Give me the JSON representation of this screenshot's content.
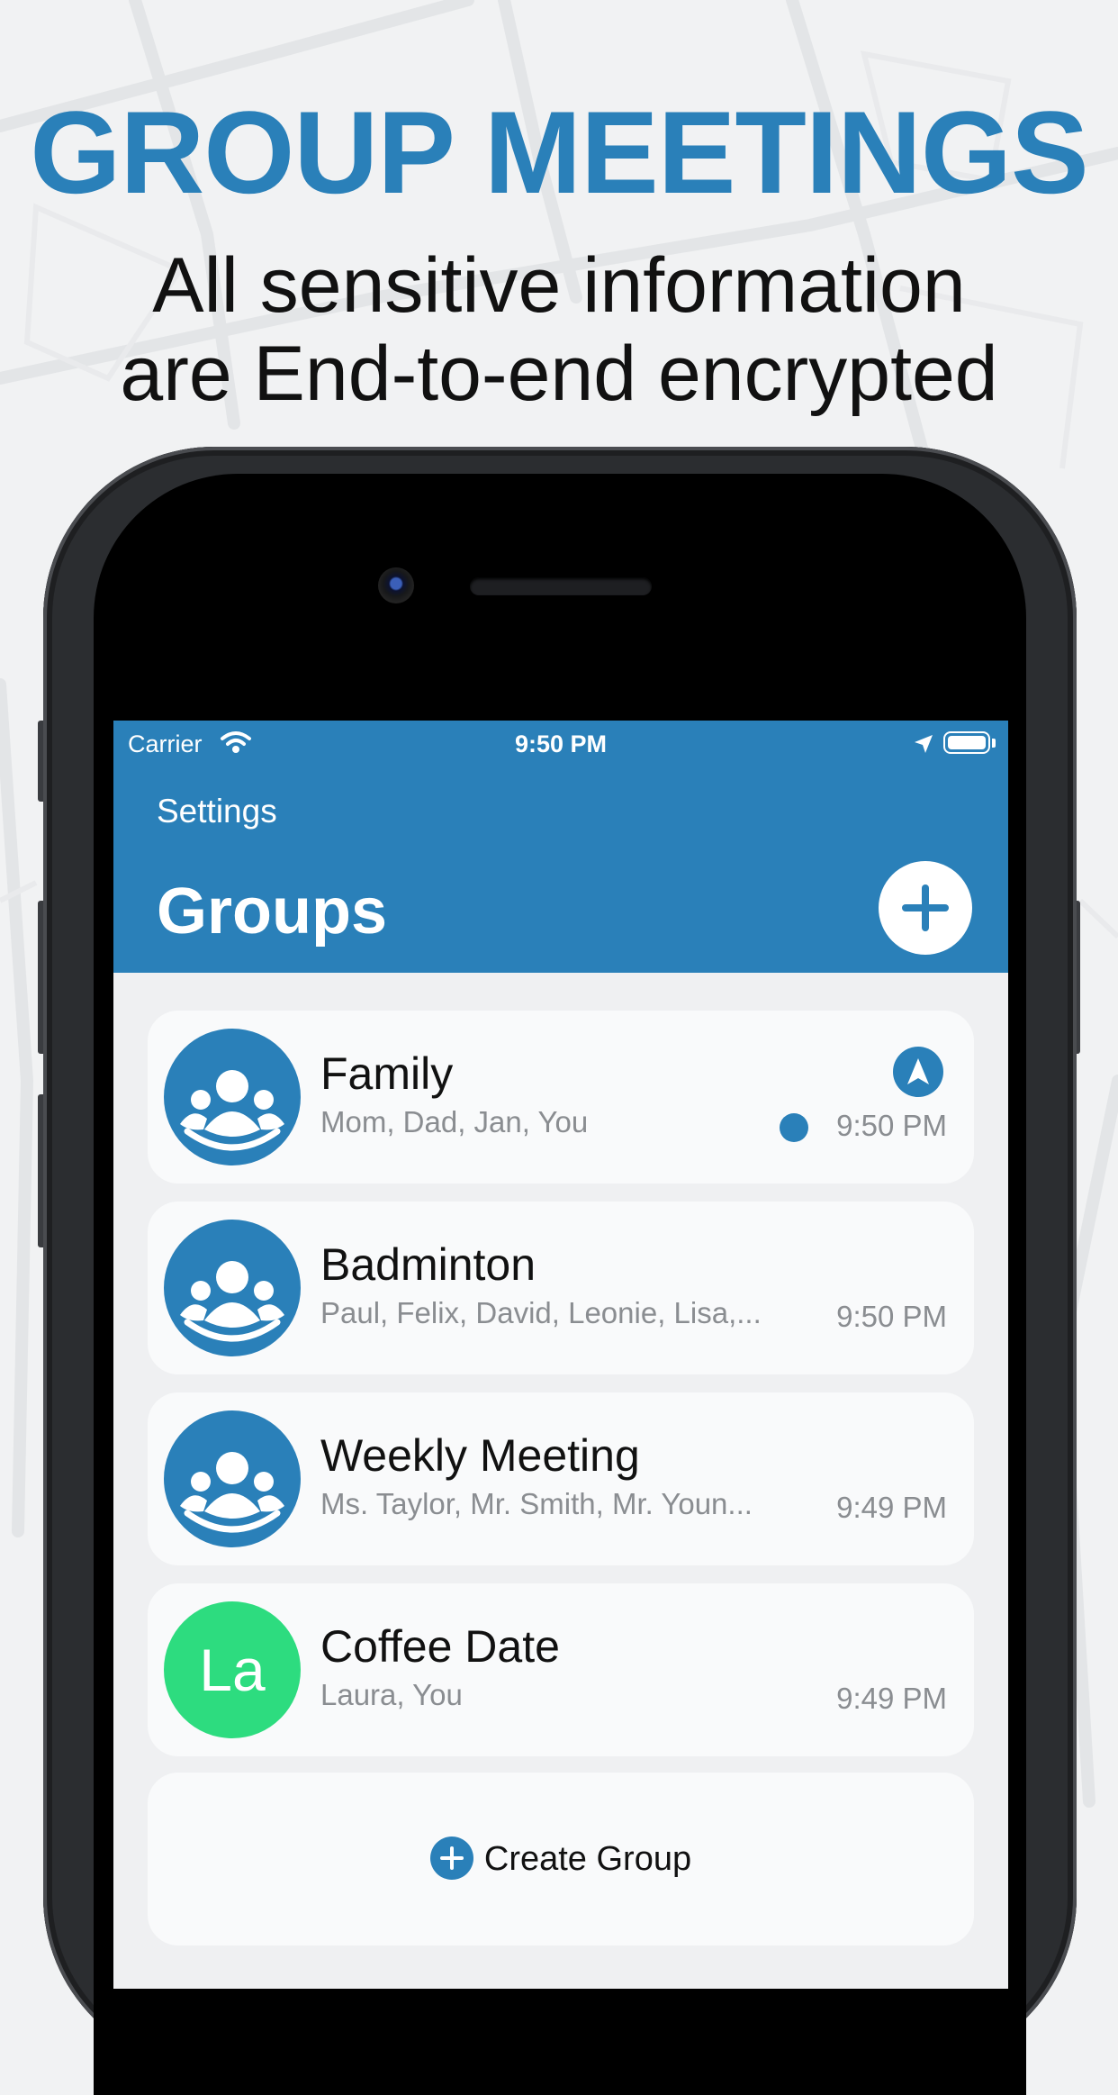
{
  "promo": {
    "title": "GROUP MEETINGS",
    "subtitle_line1": "All sensitive information",
    "subtitle_line2": "are End-to-end encrypted"
  },
  "status_bar": {
    "carrier": "Carrier",
    "time": "9:50 PM",
    "icons": [
      "wifi-icon",
      "location-arrow-icon",
      "battery-icon"
    ]
  },
  "nav": {
    "back_label": "Settings",
    "title": "Groups",
    "add_icon": "plus-icon"
  },
  "groups": [
    {
      "name": "Family",
      "members": "Mom, Dad, Jan, You",
      "time": "9:50 PM",
      "avatar": "group-icon",
      "sharing_location": true,
      "unread": true
    },
    {
      "name": "Badminton",
      "members": "Paul, Felix, David, Leonie, Lisa,...",
      "time": "9:50 PM",
      "avatar": "group-icon"
    },
    {
      "name": "Weekly Meeting",
      "members": "Ms. Taylor, Mr. Smith, Mr. Youn...",
      "time": "9:49 PM",
      "avatar": "group-icon"
    },
    {
      "name": "Coffee Date",
      "members": "Laura, You",
      "time": "9:49 PM",
      "avatar_initials": "La",
      "avatar_color": "#2ddc7f"
    }
  ],
  "create_group": {
    "label": "Create Group"
  },
  "colors": {
    "accent": "#2a80b9",
    "initials_avatar": "#2ddc7f"
  }
}
